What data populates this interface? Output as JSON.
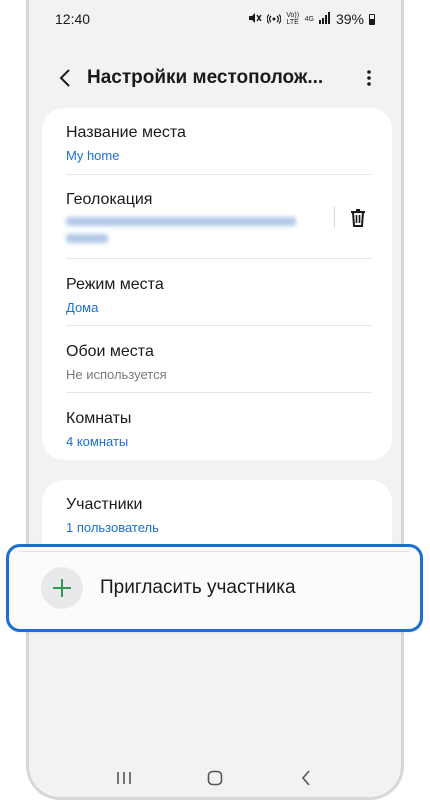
{
  "status_bar": {
    "time": "12:40",
    "battery": "39%",
    "volte_label": "Vo)) LTE",
    "network_label": "4G",
    "icons": [
      "mute-icon",
      "hotspot-icon",
      "volte-icon",
      "network-4g-icon",
      "signal-icon",
      "battery-icon"
    ]
  },
  "header": {
    "title": "Настройки местополож...",
    "back_icon": "chevron-left-icon",
    "more_icon": "more-vertical-icon"
  },
  "settings": [
    {
      "title": "Название места",
      "value": "My home",
      "value_color": "#1a6fd1"
    },
    {
      "title": "Геолокация",
      "value": "(blurred address)",
      "value_color": "#1a6fd1"
    },
    {
      "title": "Режим места",
      "value": "Дома",
      "value_color": "#1a6fd1"
    },
    {
      "title": "Обои места",
      "value": "Не используется",
      "value_color": "#7a7a7a"
    },
    {
      "title": "Комнаты",
      "value": "4 комнаты",
      "value_color": "#1a6fd1"
    }
  ],
  "members": {
    "title": "Участники",
    "value": "1 пользователь"
  },
  "invite": {
    "label": "Пригласить участника",
    "icon": "plus-icon"
  },
  "colors": {
    "accent": "#1a6fd1",
    "plus": "#2e9a52",
    "background": "#f2f2f5"
  },
  "nav": [
    "recents-icon",
    "home-icon",
    "back-icon"
  ]
}
